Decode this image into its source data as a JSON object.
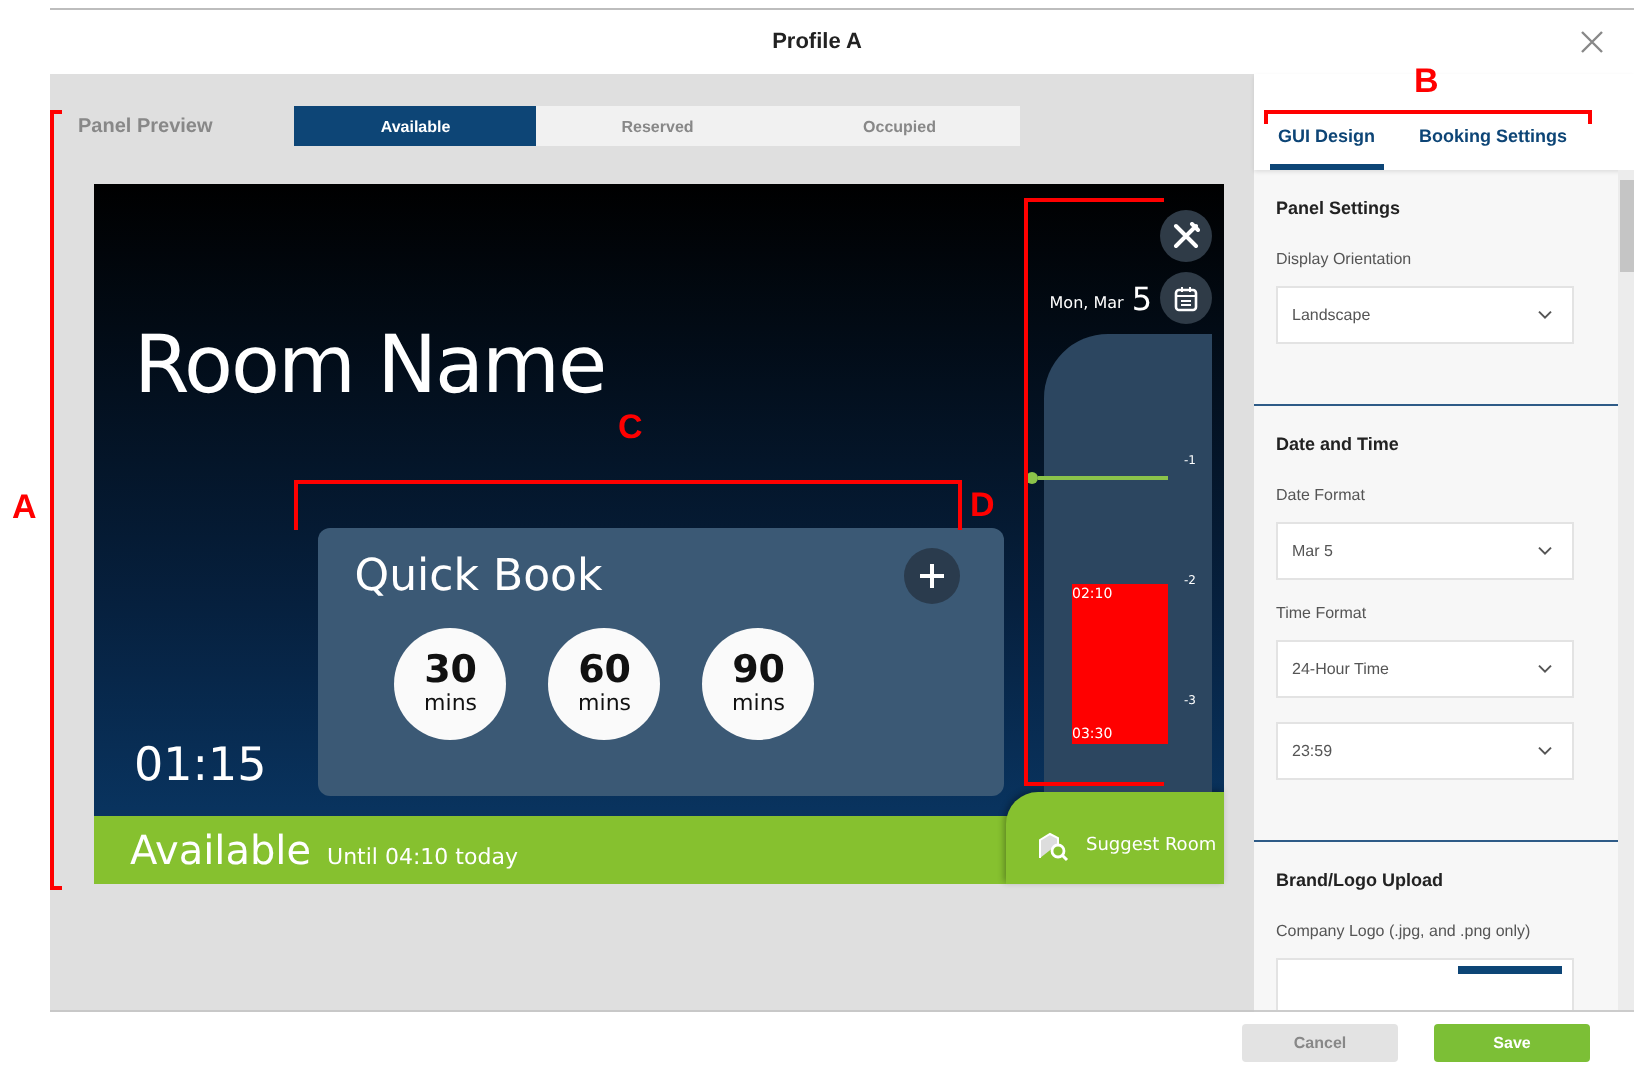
{
  "dialog": {
    "title": "Profile A"
  },
  "preview": {
    "label": "Panel Preview",
    "states": [
      {
        "label": "Available",
        "selected": true
      },
      {
        "label": "Reserved",
        "selected": false
      },
      {
        "label": "Occupied",
        "selected": false
      }
    ],
    "panel": {
      "room_name": "Room Name",
      "clock": "01:15",
      "date_prefix": "Mon, Mar",
      "date_day": "5",
      "quick_book": {
        "title": "Quick Book",
        "options": [
          {
            "value": "30",
            "unit": "mins"
          },
          {
            "value": "60",
            "unit": "mins"
          },
          {
            "value": "90",
            "unit": "mins"
          }
        ]
      },
      "timeline": {
        "ticks": [
          "-1",
          "-2",
          "-3"
        ],
        "booking": {
          "start": "02:10",
          "end": "03:30"
        }
      },
      "status": {
        "label": "Available",
        "until": "Until 04:10 today"
      },
      "suggest": "Suggest Room"
    }
  },
  "settings": {
    "tabs": [
      {
        "label": "GUI Design",
        "selected": true
      },
      {
        "label": "Booking Settings",
        "selected": false
      }
    ],
    "sections": [
      {
        "title": "Panel Settings",
        "fields": [
          {
            "kind": "select",
            "label": "Display Orientation",
            "value": "Landscape"
          }
        ]
      },
      {
        "title": "Date and Time",
        "fields": [
          {
            "kind": "select",
            "label": "Date Format",
            "value": "Mar 5"
          },
          {
            "kind": "select",
            "label": "Time Format",
            "value": "24-Hour Time"
          },
          {
            "kind": "select",
            "value": "23:59"
          }
        ]
      },
      {
        "title": "Brand/Logo Upload",
        "fields": [
          {
            "kind": "upload",
            "label": "Company Logo (.jpg, and .png only)"
          }
        ]
      }
    ]
  },
  "footer": {
    "buttons": [
      {
        "kind": "secondary",
        "label": "Cancel"
      },
      {
        "kind": "primary",
        "label": "Save"
      }
    ]
  },
  "annotations": [
    {
      "label": "A"
    },
    {
      "label": "B"
    },
    {
      "label": "C"
    },
    {
      "label": "D"
    }
  ]
}
